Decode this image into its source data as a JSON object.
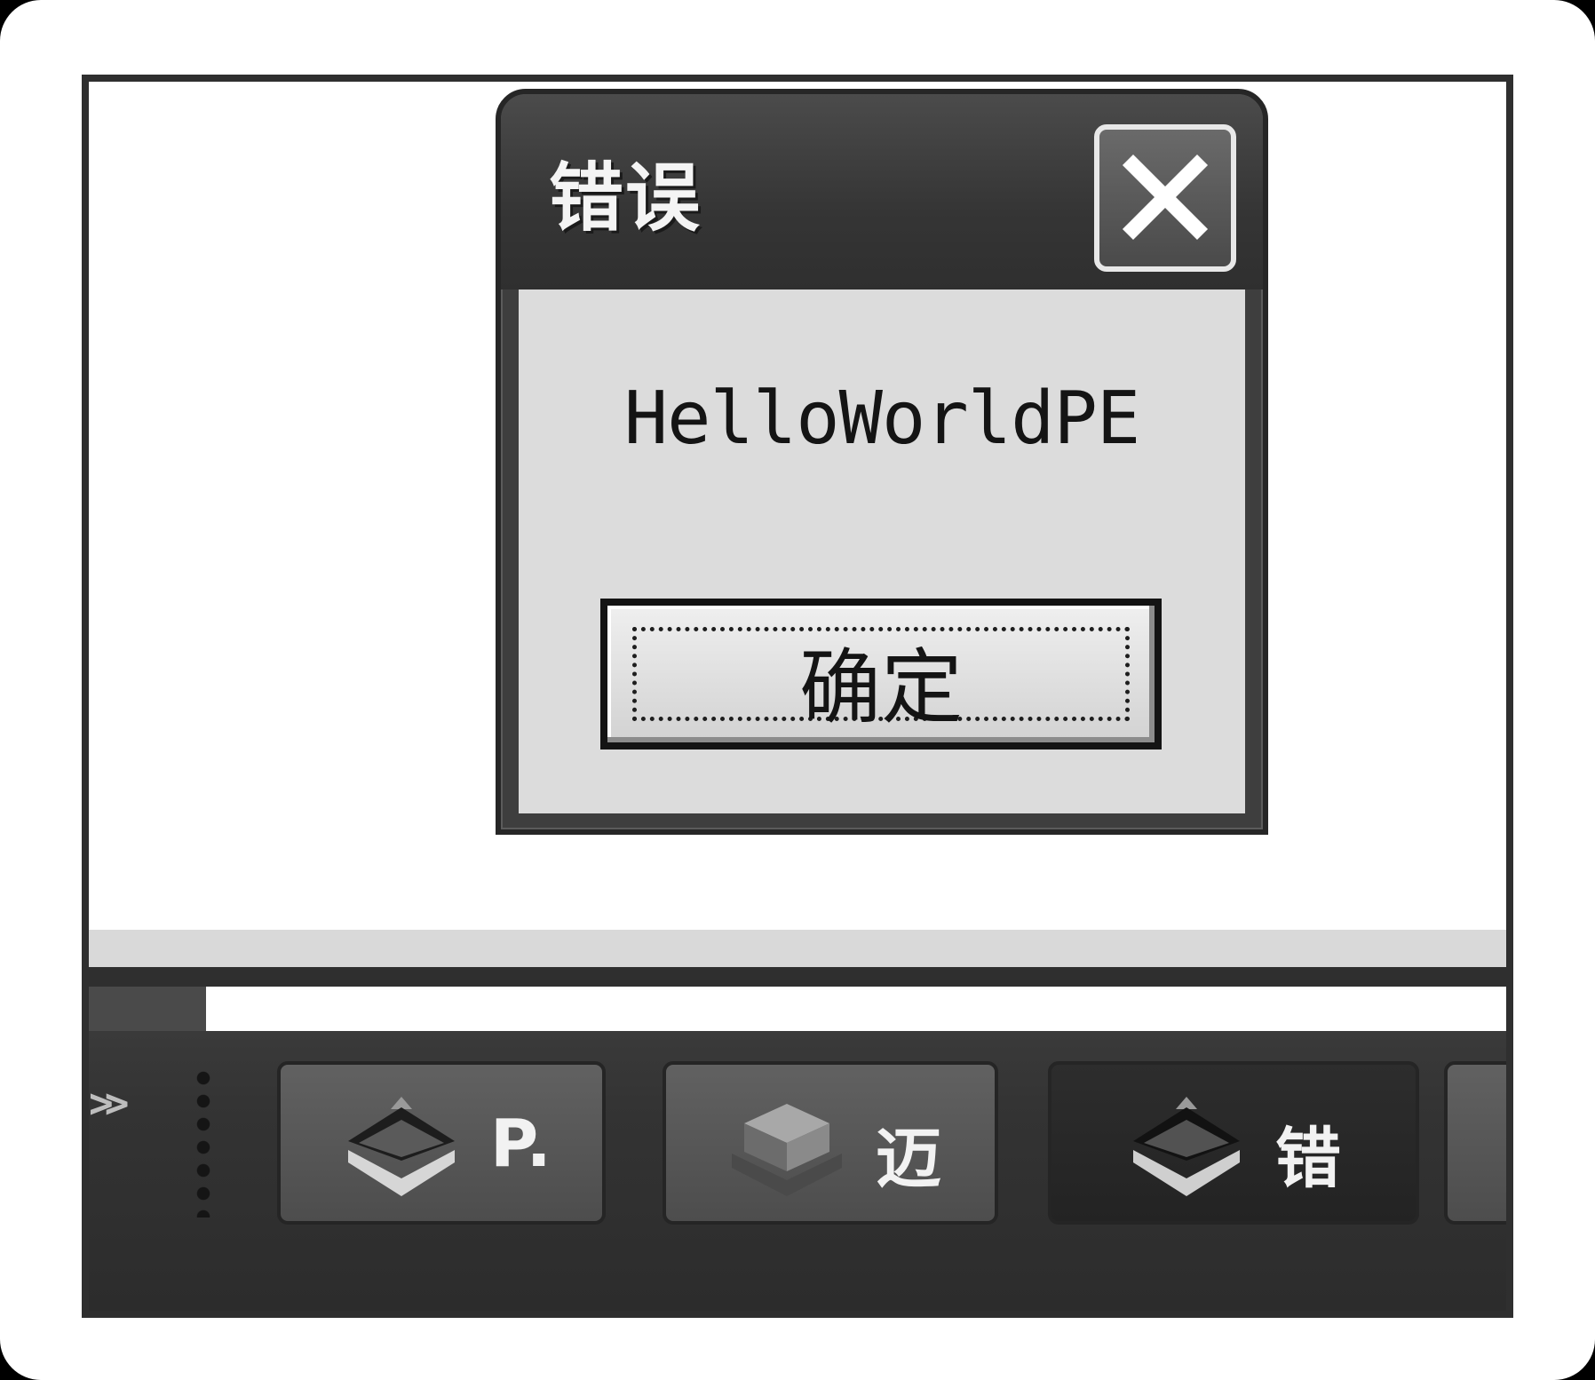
{
  "dialog": {
    "title": "错误",
    "message": "HelloWorldPE",
    "ok_label": "确定",
    "close_icon": "close-icon"
  },
  "taskbar": {
    "overflow_label": ">>",
    "items": [
      {
        "label": "P.",
        "icon": "layers-icon",
        "active": false
      },
      {
        "label": "迈",
        "icon": "box-icon",
        "active": false
      },
      {
        "label": "错",
        "icon": "layers-icon",
        "active": true
      }
    ]
  },
  "colors": {
    "titlebar": "#3e3e3e",
    "dialog_body": "#dcdcdc",
    "taskbar": "#333333",
    "active_task": "#262626"
  }
}
